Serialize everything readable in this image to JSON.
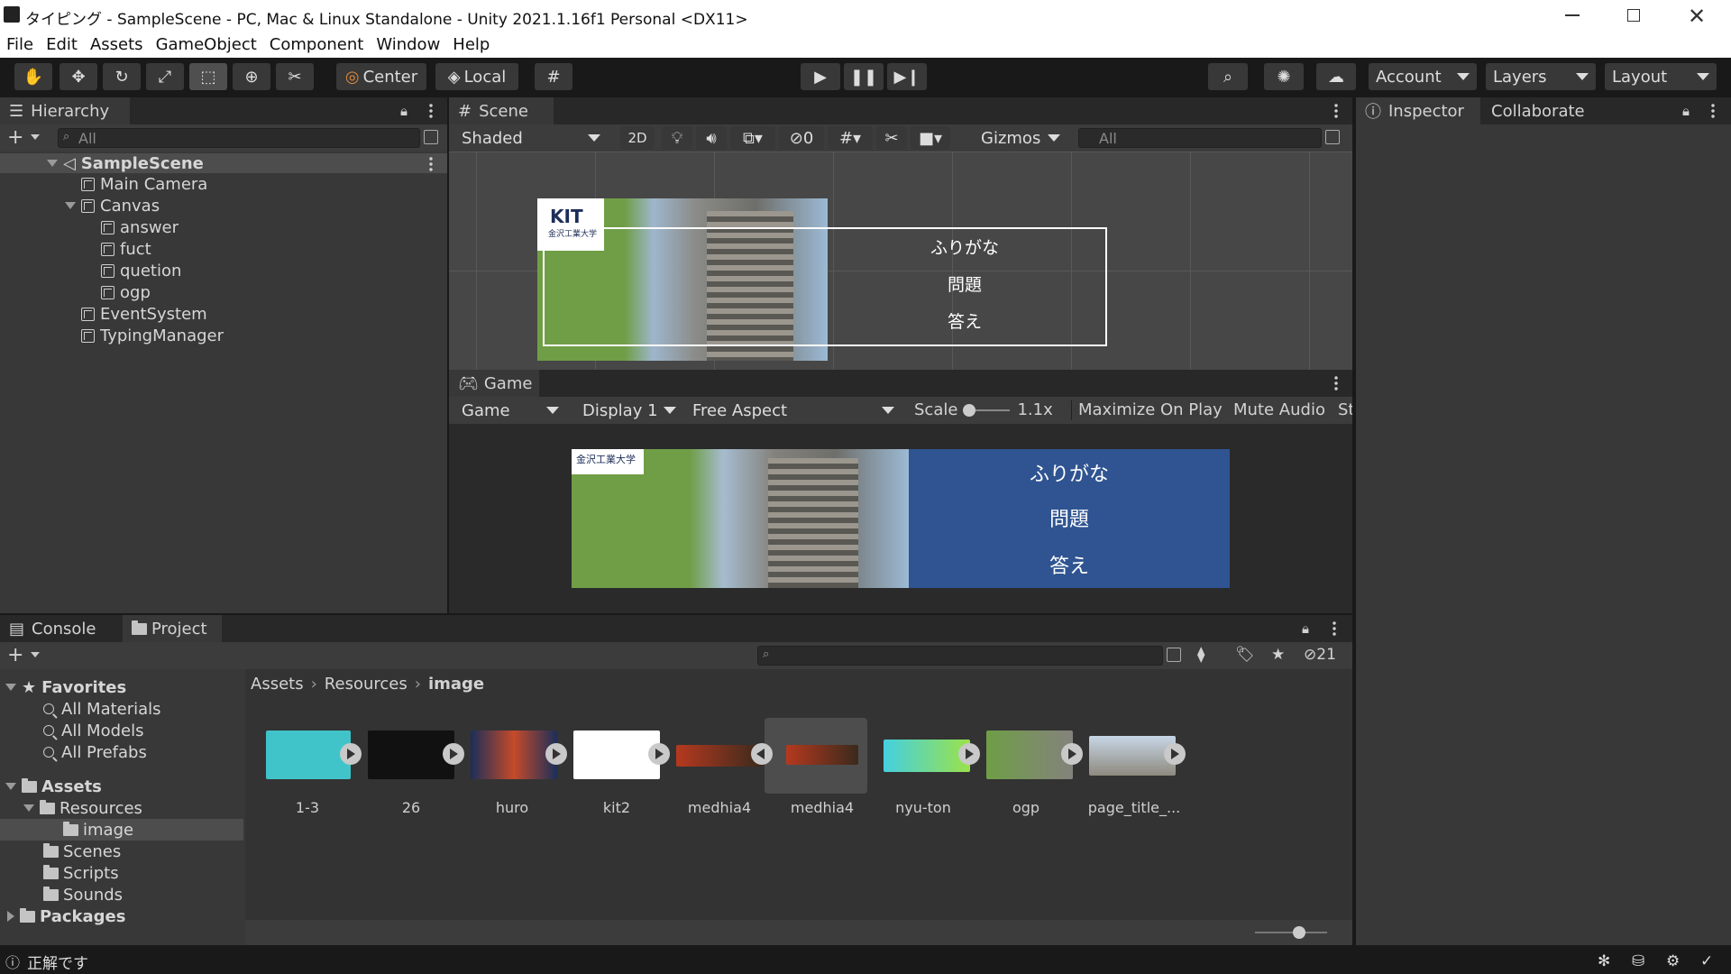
{
  "window": {
    "title": "タイピング - SampleScene - PC, Mac & Linux Standalone - Unity 2021.1.16f1 Personal <DX11>"
  },
  "menu": [
    "File",
    "Edit",
    "Assets",
    "GameObject",
    "Component",
    "Window",
    "Help"
  ],
  "toolbar": {
    "pivot": "Center",
    "space": "Local",
    "account": "Account",
    "layers": "Layers",
    "layout": "Layout"
  },
  "hierarchy": {
    "tab": "Hierarchy",
    "search_placeholder": "All",
    "scene": "SampleScene",
    "items": [
      "Main Camera",
      "Canvas",
      "answer",
      "fuct",
      "quetion",
      "ogp",
      "EventSystem",
      "TypingManager"
    ]
  },
  "scene": {
    "tab": "Scene",
    "shading": "Shaded",
    "mode2d": "2D",
    "hidden_count": "0",
    "gizmos": "Gizmos",
    "search_placeholder": "All",
    "logo_text": "KIT",
    "logo_sub": "金沢工業大学",
    "furigana": "ふりがな",
    "question": "問題",
    "answer": "答え"
  },
  "game": {
    "tab": "Game",
    "mode": "Game",
    "display": "Display 1",
    "aspect": "Free Aspect",
    "scale_label": "Scale",
    "scale_value": "1.1x",
    "maximize": "Maximize On Play",
    "mute": "Mute Audio",
    "stats": "St",
    "logo_sub": "金沢工業大学",
    "furigana": "ふりがな",
    "question": "問題",
    "answer": "答え",
    "panel_color": "#2f5491"
  },
  "inspector": {
    "tab": "Inspector",
    "tab2": "Collaborate"
  },
  "console": {
    "tab": "Console"
  },
  "project": {
    "tab": "Project",
    "hidden_count": "21",
    "favorites": "Favorites",
    "fav_items": [
      "All Materials",
      "All Models",
      "All Prefabs"
    ],
    "assets": "Assets",
    "tree": [
      "Resources",
      "image",
      "Scenes",
      "Scripts",
      "Sounds"
    ],
    "packages": "Packages",
    "breadcrumb": [
      "Assets",
      "Resources",
      "image"
    ],
    "files": [
      "1-3",
      "26",
      "huro",
      "kit2",
      "medhia4",
      "medhia4",
      "nyu-ton",
      "ogp",
      "page_title_..."
    ]
  },
  "status": {
    "message": "正解です"
  },
  "colors": {
    "accent_selected": "#4d4d4d",
    "project_sel": "#2c5d87"
  }
}
